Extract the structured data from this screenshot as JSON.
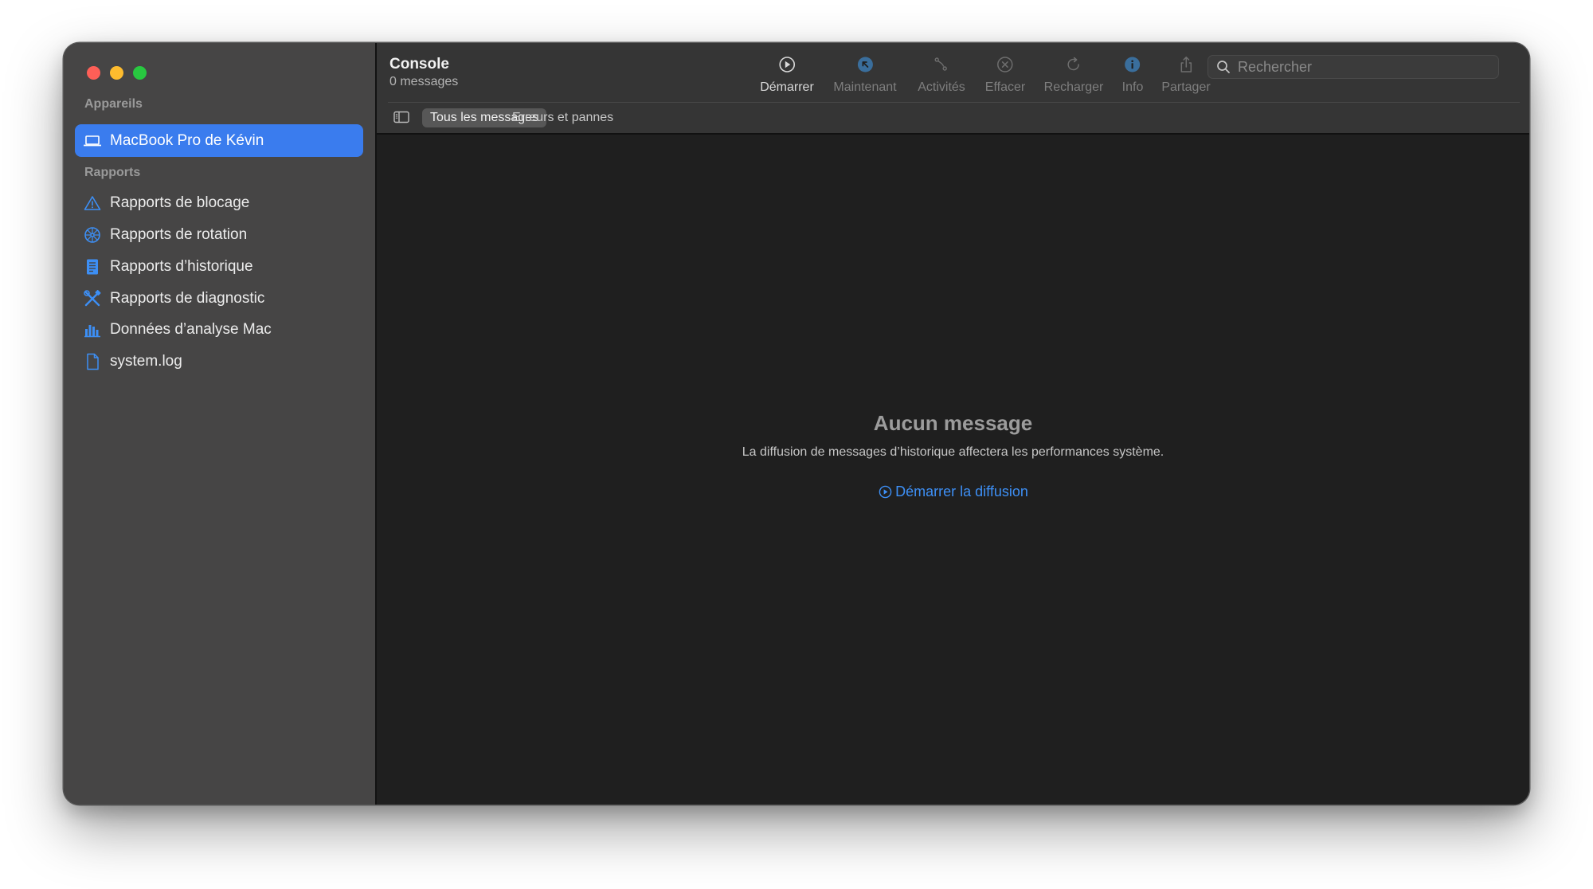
{
  "window": {
    "title": "Console",
    "subtitle": "0 messages"
  },
  "sidebar": {
    "devices_label": "Appareils",
    "device": {
      "label": "MacBook Pro de Kévin",
      "icon": "laptop-icon"
    },
    "reports_label": "Rapports",
    "items": [
      {
        "label": "Rapports de blocage",
        "icon": "warning-triangle-icon"
      },
      {
        "label": "Rapports de rotation",
        "icon": "spinning-wheel-icon"
      },
      {
        "label": "Rapports d’historique",
        "icon": "log-document-icon"
      },
      {
        "label": "Rapports de diagnostic",
        "icon": "tools-icon"
      },
      {
        "label": "Données d’analyse Mac",
        "icon": "bar-chart-icon"
      },
      {
        "label": "system.log",
        "icon": "document-icon"
      }
    ]
  },
  "toolbar": {
    "buttons": [
      {
        "label": "Démarrer",
        "icon": "play-circle-icon",
        "enabled": true
      },
      {
        "label": "Maintenant",
        "icon": "arrow-up-left-circle-icon",
        "enabled": false
      },
      {
        "label": "Activités",
        "icon": "activities-icon",
        "enabled": false
      },
      {
        "label": "Effacer",
        "icon": "clear-circle-icon",
        "enabled": false
      },
      {
        "label": "Recharger",
        "icon": "reload-icon",
        "enabled": false
      },
      {
        "label": "Info",
        "icon": "info-circle-icon",
        "enabled": false
      },
      {
        "label": "Partager",
        "icon": "share-icon",
        "enabled": false
      }
    ],
    "search": {
      "placeholder": "Rechercher",
      "value": ""
    }
  },
  "filters": {
    "active": "Tous les messages",
    "inactive": "Erreurs et pannes"
  },
  "empty_state": {
    "title": "Aucun message",
    "description": "La diffusion de messages d’historique affectera les performances système.",
    "action_label": "Démarrer la diffusion"
  },
  "colors": {
    "accent": "#3a7cee",
    "link": "#3d8ff5",
    "sidebar_bg": "#464545",
    "content_bg": "#1f1f1f",
    "toolbar_bg": "#353535",
    "close": "#fe5f57",
    "minimize": "#febc2e",
    "maximize": "#28c840"
  }
}
